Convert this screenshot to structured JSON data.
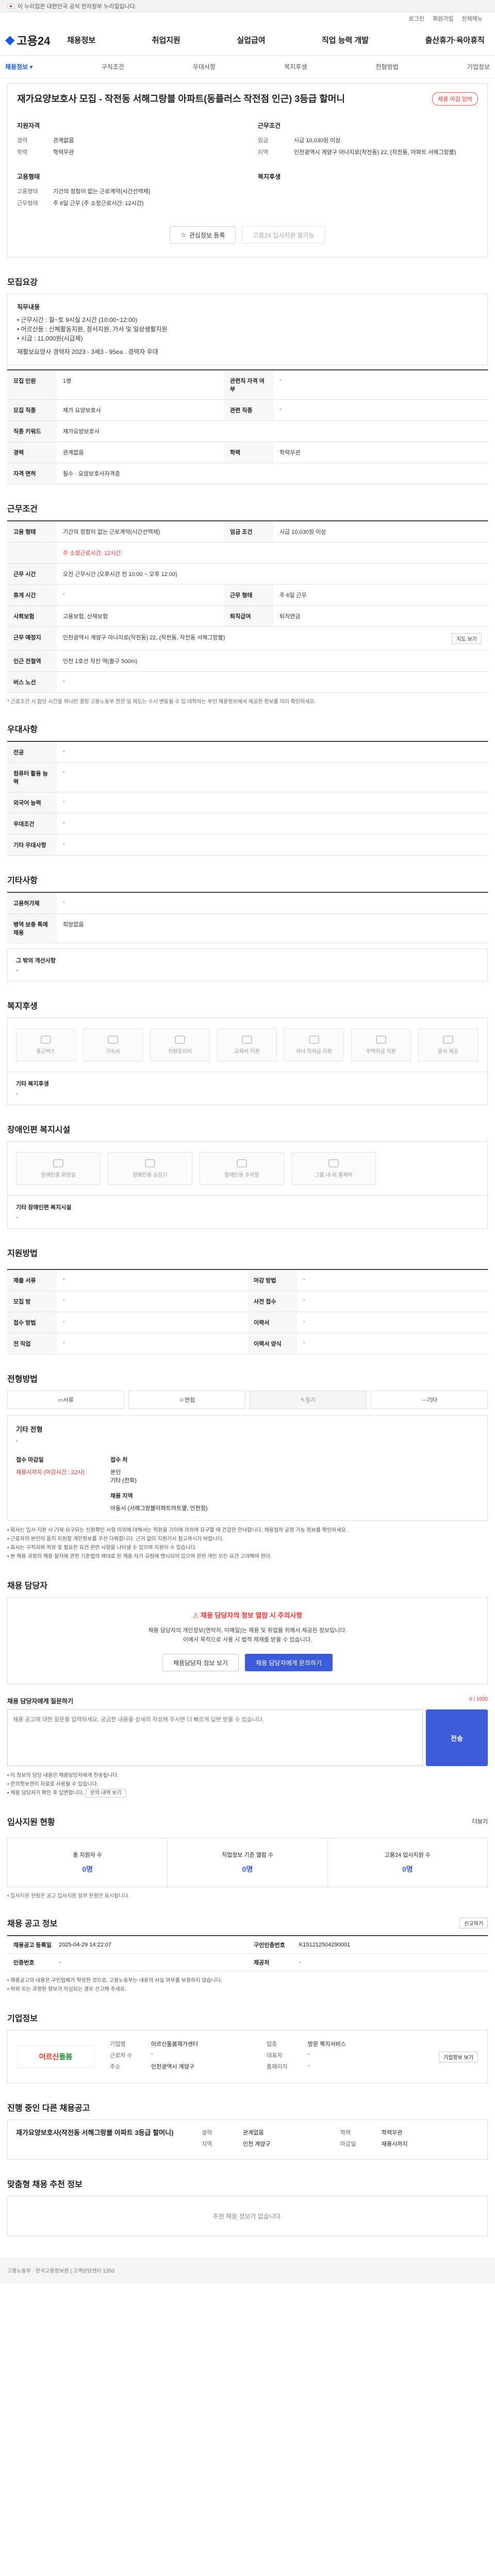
{
  "gov_bar": {
    "text": "이 누리집은 대한민국 공식 전자정부 누리집입니다."
  },
  "top_util": [
    "로그인",
    "회원가입",
    "전체메뉴"
  ],
  "header": {
    "logo": "고용24",
    "nav": [
      "채용정보",
      "취업지원",
      "실업급여",
      "직업 능력 개발",
      "출산휴가·육아휴직"
    ]
  },
  "sub_tabs": [
    "채용정보 ▾",
    "구직조건",
    "우대사항",
    "복지후생",
    "전형방법",
    "기업정보"
  ],
  "job": {
    "title": "재가요양보호사 모집 - 작전동 서해그랑블 아파트(동플러스 작전점 인근) 3등급 할머니",
    "badge": "채용 마감 임박",
    "applicant_label": "지원자격",
    "applicant": [
      {
        "k": "경력",
        "v": "관계없음"
      },
      {
        "k": "학력",
        "v": "학력무관"
      }
    ],
    "conditions_label": "근무조건",
    "conditions": [
      {
        "k": "임금",
        "v": "시급 10,030원 이상"
      },
      {
        "k": "지역",
        "v": "인천광역시 계양구 아나지로(작전동) 22, (작전동, 아파트 서해그랑블)"
      }
    ],
    "type_label": "고용형태",
    "type": [
      {
        "k": "고용형태",
        "v": "기간의 정함이 없는 근로계약(시간선택제)"
      },
      {
        "k": "근무형태",
        "v": "주 6일 근무 (주 소정근로시간: 12시간)"
      }
    ],
    "welfare_label": "복지후생",
    "btn_scrap": "관심정보 등록",
    "btn_apply": "고용24 입사지원 불가능"
  },
  "recruit": {
    "title": "모집요강",
    "duty_head": "직무내용",
    "duty_lines": [
      "• 근무시간 : 월~토 9시실 2시간 (10:00~12:00)",
      "• 어르신등 : 신체활동지원, 정서지원, 가사 및 일상생활지원",
      "• 시급 : 11,000원(시급제)"
    ],
    "duty_extra": "재활보요양사 경력자 2023 - 3세3 - 95ea . 경력자 우대",
    "rows": [
      [
        {
          "k": "모집 인원",
          "v": "1명"
        },
        {
          "k": "관련직 자격 여부",
          "v": "-"
        }
      ],
      [
        {
          "k": "모집 직종",
          "v": "재가 요양보호사"
        },
        {
          "k": "관련 직종",
          "v": "-"
        }
      ],
      [
        {
          "k": "직종 키워드",
          "v": "재가요양보호사"
        },
        {
          "k": "",
          "v": ""
        }
      ],
      [
        {
          "k": "경력",
          "v": "관계없음"
        },
        {
          "k": "학력",
          "v": "학력무관"
        }
      ],
      [
        {
          "k": "자격 면허",
          "v": "필수 · 요양보호사자격증"
        },
        {
          "k": "",
          "v": ""
        }
      ]
    ]
  },
  "work": {
    "title": "근무조건",
    "rows": [
      [
        {
          "k": "고용 형태",
          "v": "기간의 정함이 없는 근로계약(시간선택제)"
        },
        {
          "k": "임금 조건",
          "v": "시급 10,030원 이상"
        }
      ],
      [
        {
          "k": "",
          "v": "주 소정근로시간: 12시간"
        }
      ],
      [
        {
          "k": "근무 시간",
          "v": "오전 근무시간 (오후시간 전 10:00 ~ 오후 12:00)"
        }
      ],
      [
        {
          "k": "휴게 시간",
          "v": "-"
        },
        {
          "k": "근무 형태",
          "v": "주 6일 근무"
        }
      ],
      [
        {
          "k": "사회보험",
          "v": "고용보험, 산재보험"
        },
        {
          "k": "퇴직급여",
          "v": "퇴직연금"
        }
      ],
      [
        {
          "k": "근무 예정지",
          "v": "인천광역시 계양구 아나지로(작전동) 22, (작전동, 작전동 서해그랑블)"
        }
      ],
      [
        {
          "k": "인근 전철역",
          "v": "인천 1호선 작전 역(출구 500m)"
        }
      ],
      [
        {
          "k": "버스 노선",
          "v": "-"
        }
      ]
    ],
    "map_btn": "지도 보기",
    "note": "* 근로조건 시 합당 시간을 하나만 결정 고용노동부 전한 일 제도는 수시 변동될 수 있 대학하는 부인 채용정보에서 제공한 정보를 미리 확인하세요."
  },
  "prefer": {
    "title": "우대사항",
    "rows": [
      {
        "k": "전공",
        "v": "-"
      },
      {
        "k": "컴퓨터 활용 능력",
        "v": "-"
      },
      {
        "k": "외국어 능력",
        "v": "-"
      },
      {
        "k": "우대조건",
        "v": "-"
      },
      {
        "k": "기타 우대사항",
        "v": "-"
      }
    ]
  },
  "misc": {
    "title": "기타사항",
    "rows": [
      {
        "k": "고용허가제",
        "v": "-"
      },
      {
        "k": "병역 보충 특례 채용",
        "v": "희망없음"
      }
    ],
    "extra_k": "그 밖의 개선사항",
    "extra_v": "-"
  },
  "welfare": {
    "title": "복지후생",
    "items": [
      "통근버스",
      "기숙사",
      "차량유지비",
      "교육비 지원",
      "자녀 학자금 지원",
      "주택자금 지원",
      "중식 제공"
    ],
    "extra_k": "기타 복지후생",
    "extra_v": "-"
  },
  "disabled": {
    "title": "장애인편 복지시설",
    "items": [
      "장애인용 화장실",
      "장애인용 승강기",
      "장애인용 주차장",
      "그룹 내·외 휠체어"
    ],
    "extra_k": "기타 장애인편 복지시설",
    "extra_v": "-"
  },
  "apply_method": {
    "title": "지원방법",
    "rows": [
      {
        "k": "제출 서류",
        "v": "-"
      },
      {
        "k": "모집 방",
        "v": "-"
      },
      {
        "k": "접수 방법",
        "v": "-"
      },
      {
        "k": "전 직업",
        "v": "-"
      }
    ],
    "rows2": [
      {
        "k": "마감 방법",
        "v": "-"
      },
      {
        "k": "사전 접수",
        "v": "-"
      },
      {
        "k": "이력서",
        "v": "-"
      },
      {
        "k": "이력서 양식",
        "v": "-"
      }
    ]
  },
  "process": {
    "title": "전형방법",
    "steps": [
      "서류",
      "면접",
      "필기",
      "기타"
    ],
    "method_k": "기타 전형",
    "method_v": "-",
    "period_k": "접수 마감일",
    "period_v": "채용시까지 (마감시간 : 22시)",
    "contact_k": "접수 처",
    "contact_lines": [
      "본인",
      "기타 (전화)"
    ],
    "place_k": "채용 지역",
    "place_v": "아동시 (서해그랑블아파트마트옆, 인천점)",
    "notes": [
      "• 회사는 입사 지원 시 기재·요구되는 신원확인 사항 이외에 대해서는 직원을 기이에 의하여 요구할 때 건강한 안내합니다. 채용절차 공정 가능 정보를 확인하세요.",
      "• 근로자의 본인이 듣지 지원할 개인정보를 우선 다뤄합니다. 근거 없이 지원기시 참고하시기 바랍니다.",
      "• 회사는 구직자와 직원 및 필요한 요건 관련 사항을 나타낼 수 있으며 지원이 수 있습니다.",
      "• 본 채용 과정의 채용 절차에 관한 기준법의 제대로 된 채용 자가 규정에 명시되어 있으며 관한 개인 모든 요건 고려해야 한다."
    ]
  },
  "manager": {
    "title": "채용 담당자",
    "alert_title": "채용 담당자의 정보 열람 시 주의사항",
    "alert_lines": [
      "채용 담당자의 개인정보(연락처, 이메일)는 채용 및 취업을 위해서 제공된 정보입니다.",
      "이에서 목적으로 사용 시 법적 제재를 받을 수 있습니다."
    ],
    "btn_view": "채용담당자 정보 보기",
    "btn_ask": "채용 담당자에게 문의하기"
  },
  "question": {
    "title": "채용 담당자에게 질문하기",
    "limit": "0 / 1000",
    "placeholder": "채용 공고에 대한 질문을 입력하세요. 궁금한 내용을 상세히 작성해 주시면 더 빠르게 답변 받을 수 있습니다.",
    "send": "전송",
    "notes": [
      "• 이 정보의 담당 내용은 채용담당자에게 전송됩니다.",
      "• 문의정보관리 자료로 사용될 수 있습니다.",
      "• 채용 담당자가 확인 후 답변합니다."
    ],
    "history_btn": "문의 내역 보기"
  },
  "status": {
    "title": "입사지원 현황",
    "link": "더보기",
    "items": [
      {
        "label": "총 지원자 수",
        "n": "0명"
      },
      {
        "label": "직업정보 기준 열람 수",
        "n": "0명"
      },
      {
        "label": "고용24 입사지원 수",
        "n": "0명"
      }
    ],
    "note": "• 입사지원 현황은 공고 입사지원 일부 현황만 표시됩니다."
  },
  "info": {
    "title": "채용 공고 정보",
    "cells": [
      {
        "k": "채용공고 등록일",
        "v": "2025-04-29 14:22:07"
      },
      {
        "k": "구인인증번호",
        "v": "K151212504290001"
      },
      {
        "k": "인증번호",
        "v": "-"
      },
      {
        "k": "제공처",
        "v": "-"
      }
    ],
    "btn": "신고하기",
    "notes": [
      "• 채용공고의 내용은 구인업체가 작성한 것으로, 고용노동부는 내용의 사실 여부를 보증하지 않습니다.",
      "• 허위 또는 과장된 정보가 의심되는 경우 신고해 주세요."
    ]
  },
  "company": {
    "title": "기업정보",
    "logo_a": "어르신",
    "logo_b": "돌봄",
    "fields": [
      {
        "k": "기업명",
        "v": "어르신돌봄재가센터"
      },
      {
        "k": "업종",
        "v": "방문 복지서비스"
      },
      {
        "k": "근로자 수",
        "v": "-"
      },
      {
        "k": "대표자",
        "v": "-"
      },
      {
        "k": "주소",
        "v": "인천광역시 계양구"
      },
      {
        "k": "홈페이지",
        "v": "-"
      }
    ],
    "btn": "기업정보 보기"
  },
  "other": {
    "title": "진행 중인 다른 채용공고",
    "job_title": "재가요양보호사(작전동 서해그랑블 아파트 3등급 할머니)",
    "fields": [
      {
        "k": "경력",
        "v": "관계없음"
      },
      {
        "k": "학력",
        "v": "학력무관"
      },
      {
        "k": "지역",
        "v": "인천 계양구"
      },
      {
        "k": "마감일",
        "v": "채용시까지"
      }
    ]
  },
  "recommend": {
    "title": "맞춤형 채용 추천 정보",
    "empty": "추천 채용 정보가 없습니다."
  },
  "footer": {
    "text": "고용노동부 · 한국고용정보원 | 고객상담센터 1350"
  }
}
